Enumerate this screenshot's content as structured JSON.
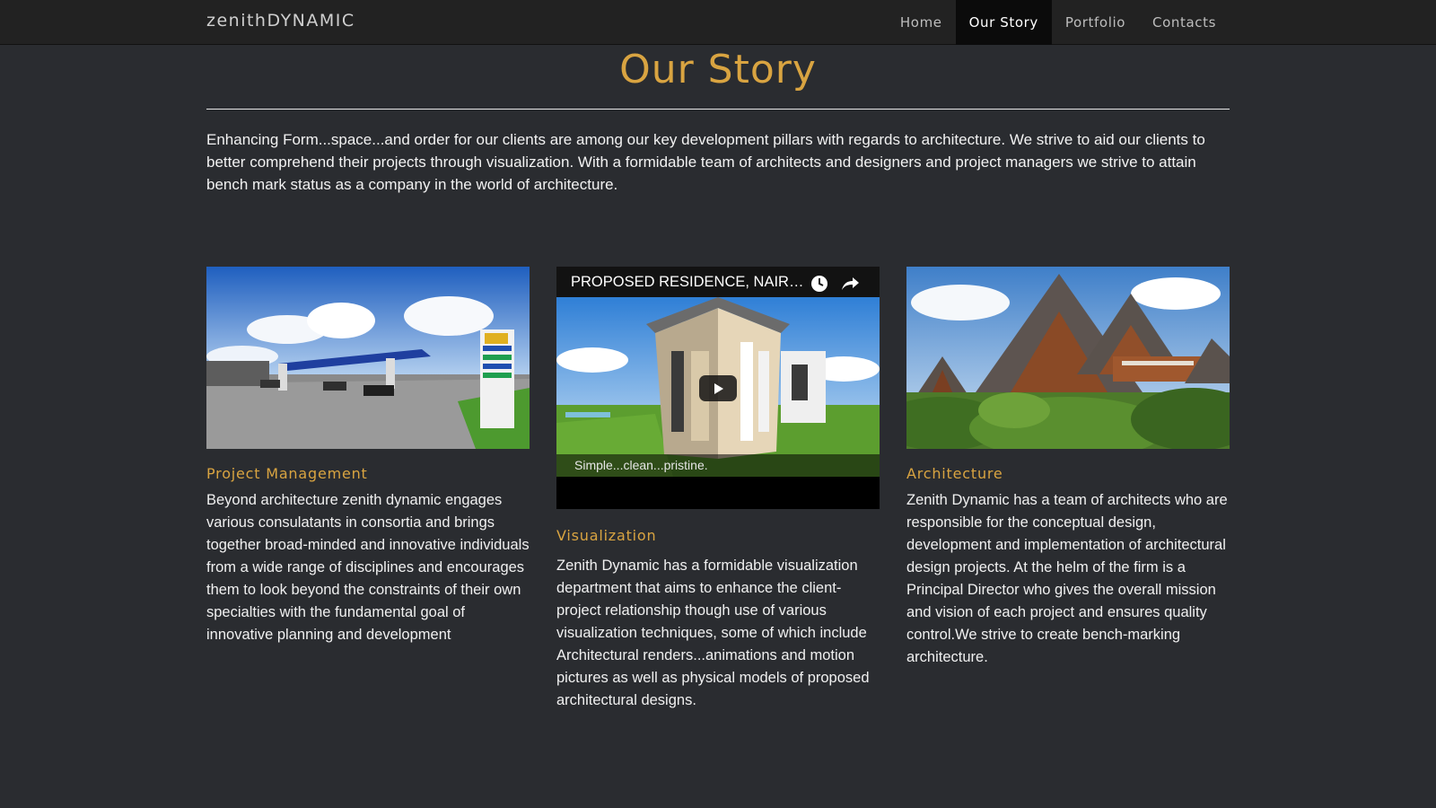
{
  "nav": {
    "brand": "zenithDYNAMIC",
    "items": [
      {
        "label": "Home",
        "active": false
      },
      {
        "label": "Our Story",
        "active": true
      },
      {
        "label": "Portfolio",
        "active": false
      },
      {
        "label": "Contacts",
        "active": false
      }
    ]
  },
  "main": {
    "title": "Our Story",
    "intro": "Enhancing Form...space...and order for our clients are among our key development pillars with regards to architecture. We strive to aid our clients to better comprehend their projects through visualization. With a formidable team of architects and designers and project managers we strive to attain bench mark status as a company in the world of architecture."
  },
  "columns": [
    {
      "title": "Project Management",
      "text": "Beyond architecture zenith dynamic engages various consulatants in consortia and brings together broad-minded and innovative individuals from a wide range of disciplines and encourages them to look beyond the constraints of their own specialties with the fundamental goal of innovative planning and development"
    },
    {
      "title": "Visualization",
      "text": "Zenith Dynamic has a formidable visualization department that aims to enhance the client-project relationship though use of various visualization techniques, some of which include Architectural renders...animations and motion pictures as well as physical models of proposed architectural designs."
    },
    {
      "title": "Architecture",
      "text": "Zenith Dynamic has a team of architects who are responsible for the conceptual design, development and implementation of architectural design projects. At the helm of the firm is a Principal Director who gives the overall mission and vision of each project and ensures quality control.We strive to create bench-marking architecture."
    }
  ],
  "video": {
    "title": "PROPOSED RESIDENCE, NAIROBI",
    "caption": "Simple...clean...pristine.",
    "icons": [
      "watch-later-icon",
      "share-icon",
      "play-icon"
    ]
  },
  "colors": {
    "accent": "#d9a441",
    "background": "#2a2c30",
    "navbar": "#222222",
    "nav_active": "#0b0b0b"
  }
}
